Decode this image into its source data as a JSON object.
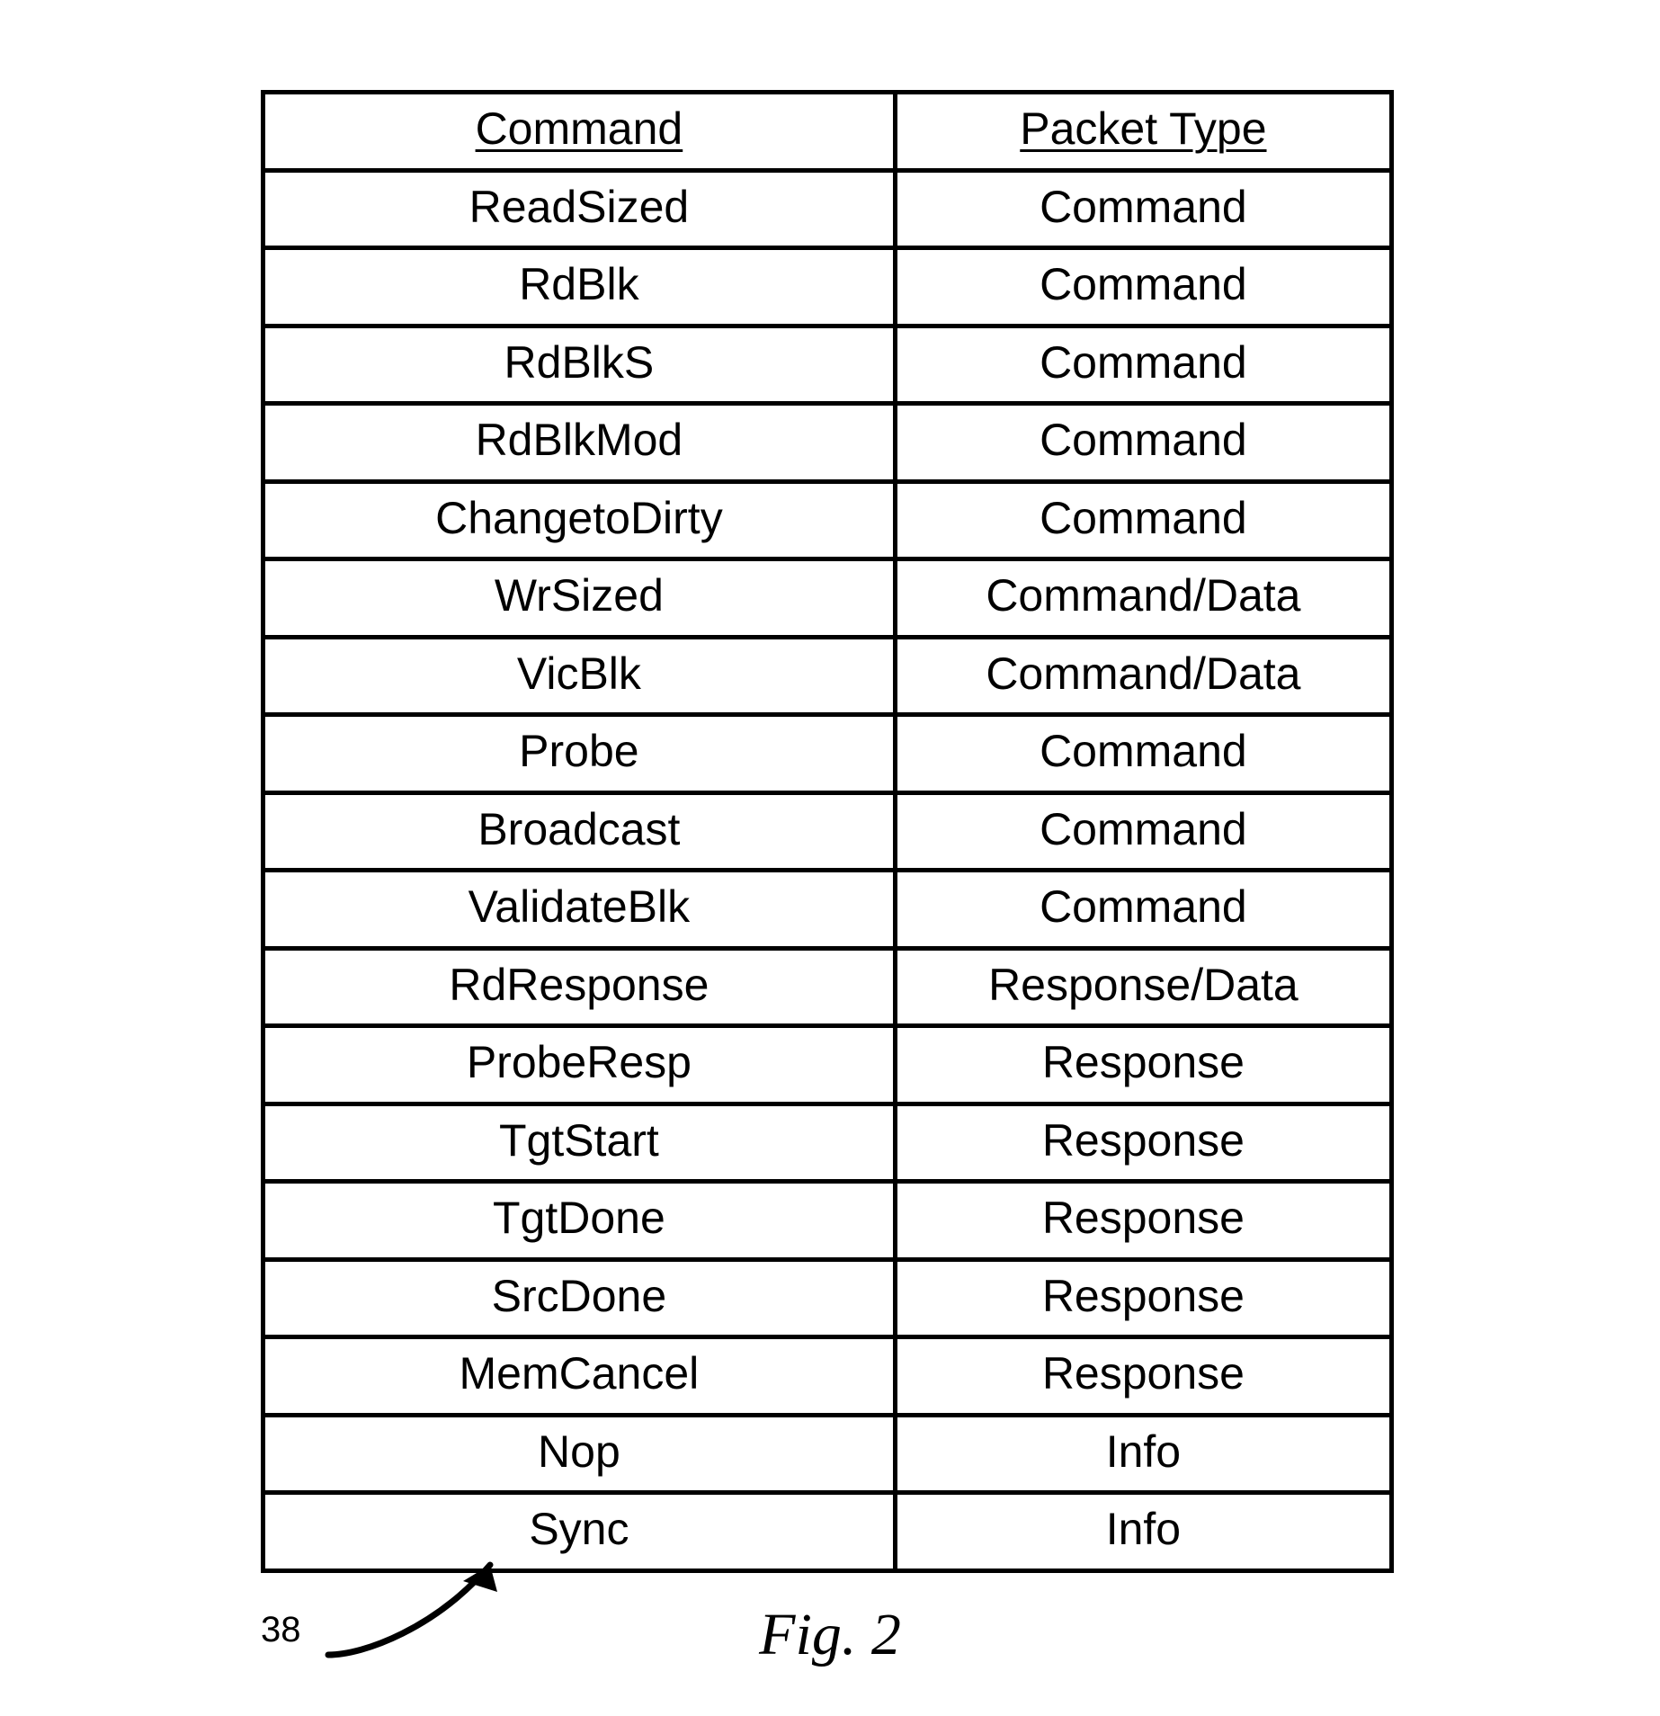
{
  "table": {
    "headers": {
      "command": "Command",
      "packet_type": "Packet Type"
    },
    "rows": [
      {
        "command": "ReadSized",
        "packet_type": "Command"
      },
      {
        "command": "RdBlk",
        "packet_type": "Command"
      },
      {
        "command": "RdBlkS",
        "packet_type": "Command"
      },
      {
        "command": "RdBlkMod",
        "packet_type": "Command"
      },
      {
        "command": "ChangetoDirty",
        "packet_type": "Command"
      },
      {
        "command": "WrSized",
        "packet_type": "Command/Data"
      },
      {
        "command": "VicBlk",
        "packet_type": "Command/Data"
      },
      {
        "command": "Probe",
        "packet_type": "Command"
      },
      {
        "command": "Broadcast",
        "packet_type": "Command"
      },
      {
        "command": "ValidateBlk",
        "packet_type": "Command"
      },
      {
        "command": "RdResponse",
        "packet_type": "Response/Data"
      },
      {
        "command": "ProbeResp",
        "packet_type": "Response"
      },
      {
        "command": "TgtStart",
        "packet_type": "Response"
      },
      {
        "command": "TgtDone",
        "packet_type": "Response"
      },
      {
        "command": "SrcDone",
        "packet_type": "Response"
      },
      {
        "command": "MemCancel",
        "packet_type": "Response"
      },
      {
        "command": "Nop",
        "packet_type": "Info"
      },
      {
        "command": "Sync",
        "packet_type": "Info"
      }
    ]
  },
  "reference_number": "38",
  "figure_caption": "Fig. 2"
}
